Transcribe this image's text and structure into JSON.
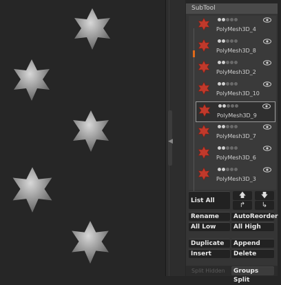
{
  "panel": {
    "title": "SubTool",
    "subtools": [
      {
        "name": "PolyMesh3D_4",
        "selected": false
      },
      {
        "name": "PolyMesh3D_8",
        "selected": false
      },
      {
        "name": "PolyMesh3D_2",
        "selected": false
      },
      {
        "name": "PolyMesh3D_10",
        "selected": false
      },
      {
        "name": "PolyMesh3D_9",
        "selected": true
      },
      {
        "name": "PolyMesh3D_7",
        "selected": false
      },
      {
        "name": "PolyMesh3D_6",
        "selected": false
      },
      {
        "name": "PolyMesh3D_3",
        "selected": false
      }
    ],
    "buttons": {
      "list_all": "List All",
      "rename": "Rename",
      "auto_reorder": "AutoReorder",
      "all_low": "All Low",
      "all_high": "All High",
      "duplicate": "Duplicate",
      "append": "Append",
      "insert": "Insert",
      "delete": "Delete",
      "split_hidden": "Split Hidden",
      "groups_split": "Groups Split"
    },
    "arrow_icons": [
      "up-arrow-icon",
      "down-arrow-icon",
      "move-up-icon",
      "move-down-icon"
    ]
  },
  "colors": {
    "background": "#262626",
    "panel": "#353535",
    "star_thumb": "#c0392b",
    "scroll_accent": "#e06a1a"
  }
}
